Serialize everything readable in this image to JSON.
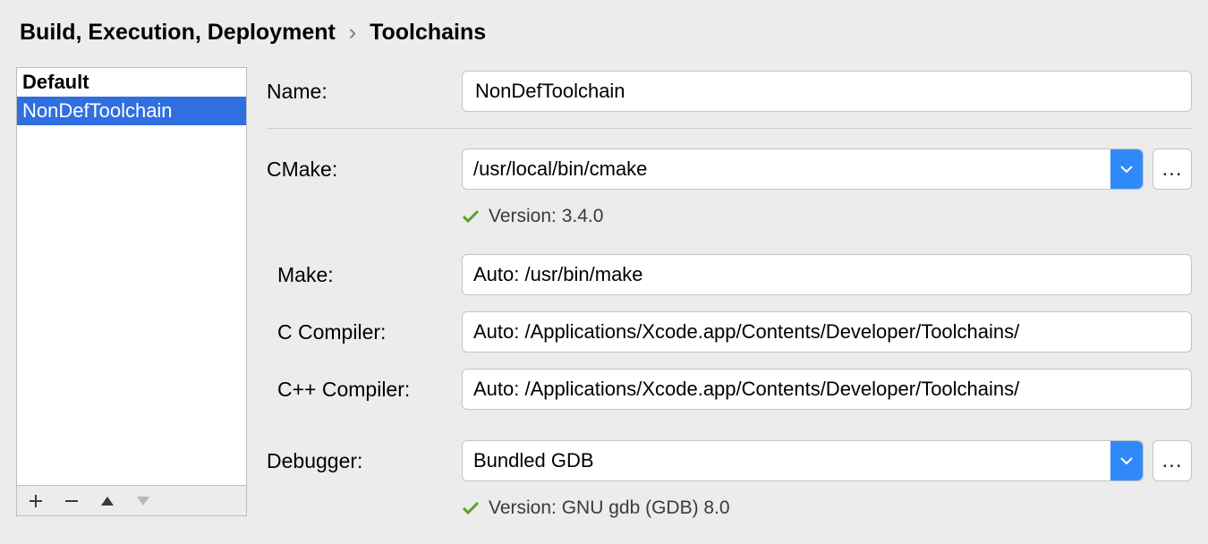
{
  "breadcrumb": {
    "parent": "Build, Execution, Deployment",
    "current": "Toolchains"
  },
  "toolchains": {
    "items": [
      "Default",
      "NonDefToolchain"
    ],
    "default_index": 0,
    "selected_index": 1
  },
  "toolbar_icons": {
    "add": "plus-icon",
    "remove": "minus-icon",
    "up": "triangle-up-icon",
    "down": "triangle-down-icon"
  },
  "form": {
    "name_label": "Name:",
    "name_value": "NonDefToolchain",
    "cmake_label": "CMake:",
    "cmake_value": "/usr/local/bin/cmake",
    "cmake_status": "Version: 3.4.0",
    "make_label": "Make:",
    "make_value": "Auto: /usr/bin/make",
    "cc_label": "C Compiler:",
    "cc_value": "Auto: /Applications/Xcode.app/Contents/Developer/Toolchains/",
    "cxx_label": "C++ Compiler:",
    "cxx_value": "Auto: /Applications/Xcode.app/Contents/Developer/Toolchains/",
    "debugger_label": "Debugger:",
    "debugger_value": "Bundled GDB",
    "debugger_status": "Version: GNU gdb (GDB) 8.0",
    "browse_label": "..."
  }
}
